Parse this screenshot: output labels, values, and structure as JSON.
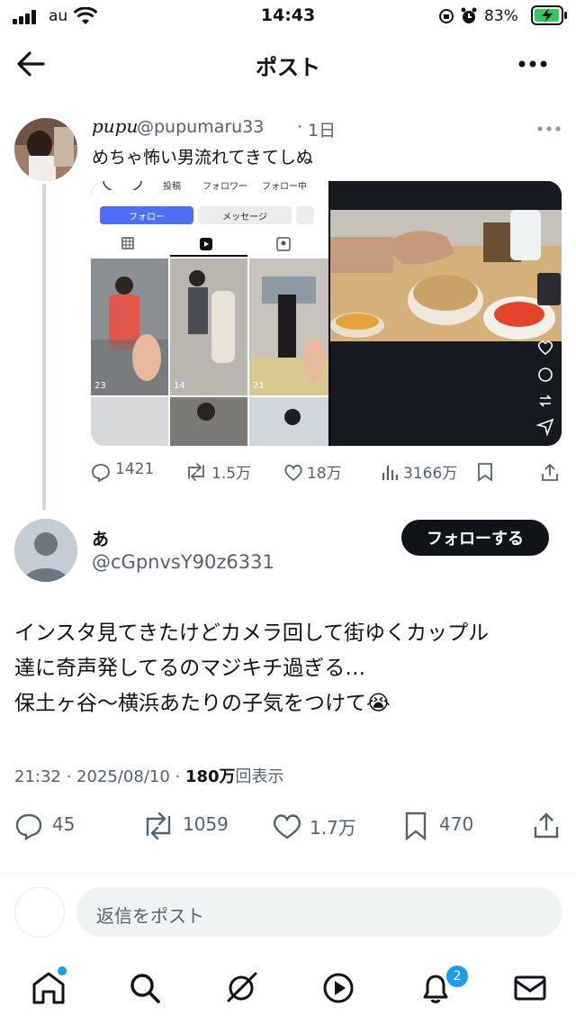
{
  "status_bar": {
    "carrier": "au",
    "time": "14:43",
    "battery": "83%"
  },
  "header": {
    "title": "ポスト"
  },
  "quoted_post": {
    "display_name": "pupu",
    "handle": "@pupumaru33",
    "time": "1日",
    "text": "めちゃ怖い男流れてきてしぬ",
    "media": {
      "profile_labels": {
        "posts": "投稿",
        "followers": "フォロワー",
        "following": "フォロー中"
      },
      "follow_label": "フォロー",
      "message_label": "メッセージ",
      "view_counts": [
        "23",
        "14",
        "21"
      ]
    },
    "stats": {
      "replies": "1421",
      "reposts": "1.5万",
      "likes": "18万",
      "views": "3166万"
    }
  },
  "main_post": {
    "display_name": "あ",
    "handle": "@cGpnvsY90z6331",
    "follow_button": "フォローする",
    "text_lines": [
      "インスタ見てきたけどカメラ回して街ゆくカップル",
      "達に奇声発してるのマジキチ過ぎる…",
      "保土ヶ谷〜横浜あたりの子気をつけて"
    ],
    "emoji": "😭",
    "time": "21:32",
    "date": "2025/08/10",
    "views_num": "180万",
    "views_label": "回表示",
    "stats": {
      "replies": "45",
      "reposts": "1059",
      "likes": "1.7万",
      "bookmarks": "470"
    }
  },
  "reply": {
    "placeholder": "返信をポスト"
  },
  "bottom_nav": {
    "notification_count": "2"
  },
  "colors": {
    "accent": "#1d9bf0",
    "text": "#0f1419",
    "muted": "#536471"
  }
}
